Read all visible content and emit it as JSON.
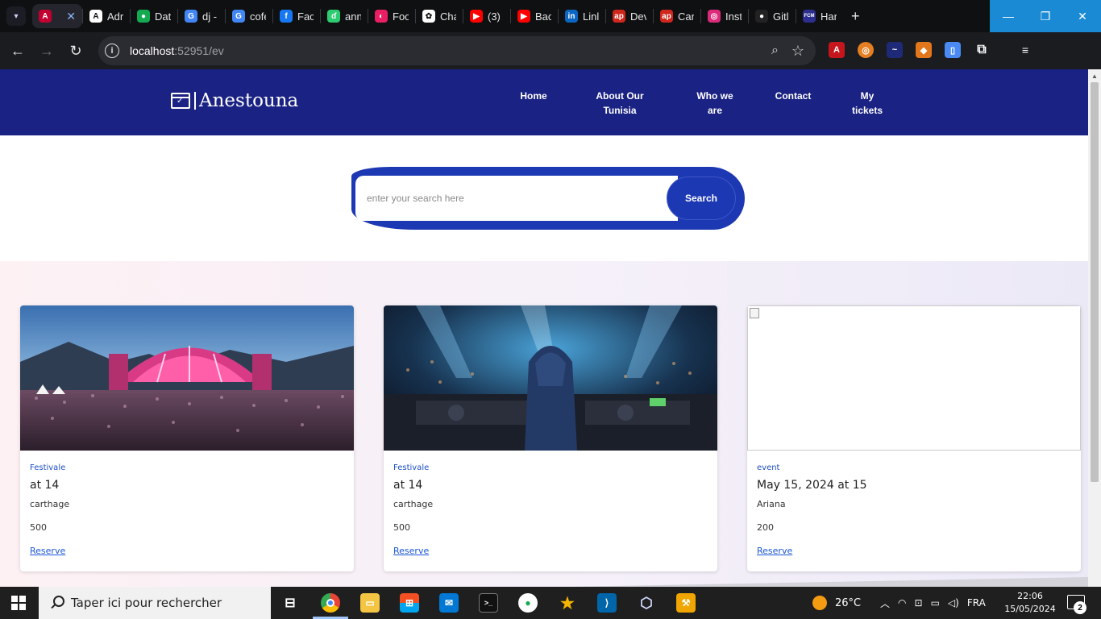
{
  "browser": {
    "tabs": [
      {
        "label": "Adr",
        "icon": "angular-icon",
        "color": "#ffffff",
        "glyph": "A"
      },
      {
        "label": "Dat",
        "icon": "mongodb-icon",
        "color": "#13aa52",
        "glyph": "●"
      },
      {
        "label": "dj -",
        "icon": "google-icon",
        "color": "#4285f4",
        "glyph": "G"
      },
      {
        "label": "cofe",
        "icon": "google-icon",
        "color": "#4285f4",
        "glyph": "G"
      },
      {
        "label": "Fac",
        "icon": "facebook-icon",
        "color": "#1877f2",
        "glyph": "f"
      },
      {
        "label": "ann",
        "icon": "leaf-icon",
        "color": "#2ecc71",
        "glyph": "ɗ"
      },
      {
        "label": "Foo",
        "icon": "app-icon",
        "color": "#e91e63",
        "glyph": "◐"
      },
      {
        "label": "Cha",
        "icon": "chatgpt-icon",
        "color": "#ffffff",
        "glyph": "✿"
      },
      {
        "label": "(3)",
        "icon": "youtube-icon",
        "color": "#ff0000",
        "glyph": "▶"
      },
      {
        "label": "Bac",
        "icon": "youtube-icon",
        "color": "#ff0000",
        "glyph": "▶"
      },
      {
        "label": "Linl",
        "icon": "linkedin-icon",
        "color": "#0a66c2",
        "glyph": "in"
      },
      {
        "label": "Dev",
        "icon": "adp-icon",
        "color": "#d0271d",
        "glyph": "ap"
      },
      {
        "label": "Car",
        "icon": "adp-icon",
        "color": "#d0271d",
        "glyph": "ap"
      },
      {
        "label": "Inst",
        "icon": "instagram-icon",
        "color": "#dd2a7b",
        "glyph": "◎"
      },
      {
        "label": "Gitl",
        "icon": "github-icon",
        "color": "#222222",
        "glyph": "●"
      },
      {
        "label": "Har",
        "icon": "fcm-icon",
        "color": "#2c2f8f",
        "glyph": "FCM"
      }
    ],
    "url_host": "localhost",
    "url_rest": ":52951/ev"
  },
  "site": {
    "logo_text": "Anestouna",
    "nav": {
      "home": "Home",
      "about": "About Our Tunisia",
      "who": "Who we are",
      "contact": "Contact",
      "tickets": "My tickets"
    },
    "search": {
      "placeholder": "enter your search here",
      "button": "Search"
    }
  },
  "events": [
    {
      "category": "Festivale",
      "title": "at 14",
      "location": "carthage",
      "capacity": "500",
      "link": "Reserve",
      "image": "festival-crowd"
    },
    {
      "category": "Festivale",
      "title": "at 14",
      "location": "carthage",
      "capacity": "500",
      "link": "Reserve",
      "image": "dj-set"
    },
    {
      "category": "event",
      "title": "May 15, 2024 at 15",
      "location": "Ariana",
      "capacity": "200",
      "link": "Reserve",
      "image": "broken"
    }
  ],
  "taskbar": {
    "search_placeholder": "Taper ici pour rechercher",
    "weather": "26°C",
    "language": "FRA",
    "time": "22:06",
    "date": "15/05/2024",
    "notifications": "2"
  },
  "colors": {
    "header": "#1a2283",
    "accent": "#1d38b3",
    "link": "#1a56d6"
  }
}
